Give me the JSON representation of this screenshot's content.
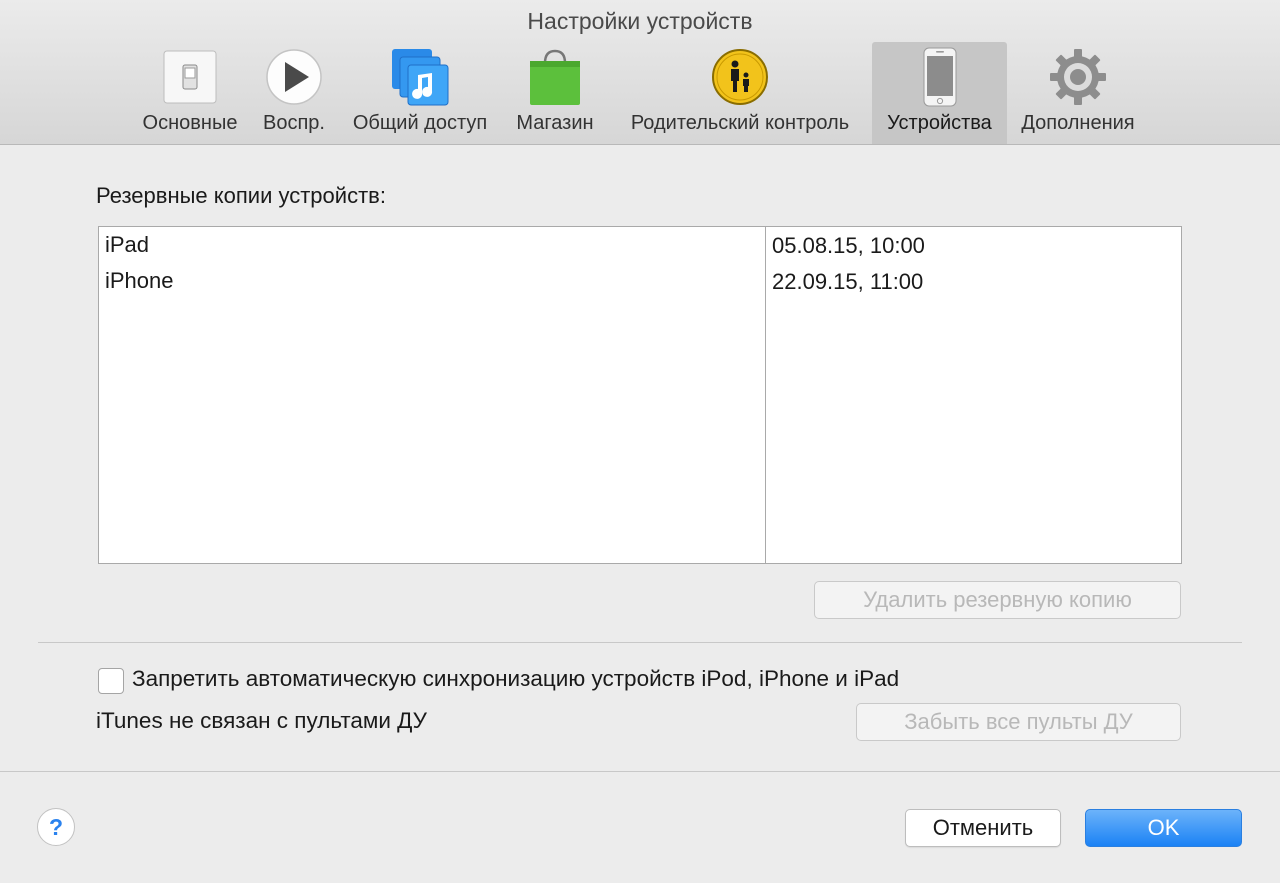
{
  "window": {
    "title": "Настройки устройств"
  },
  "toolbar": {
    "tabs": [
      {
        "label": "Основные",
        "icon": "switch-icon"
      },
      {
        "label": "Воспр.",
        "icon": "play-icon"
      },
      {
        "label": "Общий доступ",
        "icon": "music-library-icon"
      },
      {
        "label": "Магазин",
        "icon": "shopping-bag-icon"
      },
      {
        "label": "Родительский контроль",
        "icon": "parental-control-icon"
      },
      {
        "label": "Устройства",
        "icon": "iphone-icon",
        "selected": true
      },
      {
        "label": "Дополнения",
        "icon": "gear-icon"
      }
    ]
  },
  "backups": {
    "label": "Резервные копии устройств:",
    "rows": [
      {
        "name": "iPad",
        "date": "05.08.15, 10:00"
      },
      {
        "name": "iPhone",
        "date": "22.09.15, 11:00"
      }
    ],
    "delete_button": "Удалить резервную копию"
  },
  "sync": {
    "checkbox_label": "Запретить автоматическую синхронизацию устройств iPod, iPhone и iPad",
    "checked": false
  },
  "remotes": {
    "status": "iTunes не связан с пультами ДУ",
    "forget_button": "Забыть все пульты ДУ"
  },
  "footer": {
    "help": "?",
    "cancel_button": "Отменить",
    "ok_button": "OK"
  },
  "colors": {
    "accent": "#1b82f5",
    "background": "#ececec",
    "selected_tab": "#c6c6c6"
  }
}
